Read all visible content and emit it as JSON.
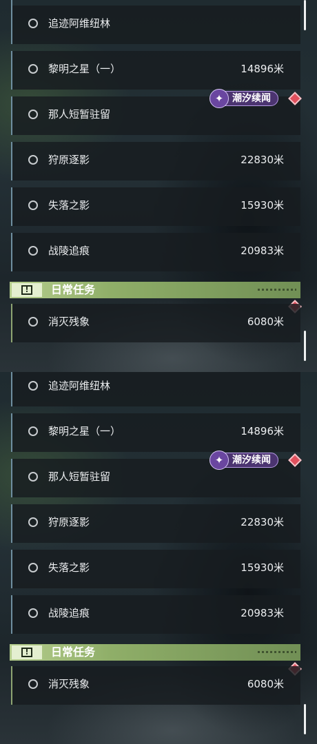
{
  "views": [
    {
      "quests": [
        {
          "name": "追迹阿维纽林",
          "distance": ""
        },
        {
          "name": "黎明之星（一）",
          "distance": "14896米"
        },
        {
          "name": "那人短暂驻留",
          "distance": ""
        },
        {
          "name": "狩原逐影",
          "distance": "22830米"
        },
        {
          "name": "失落之影",
          "distance": "15930米"
        },
        {
          "name": "战陵追痕",
          "distance": "20983米"
        }
      ],
      "badge": {
        "label": "潮汐续闻",
        "icon": "sparkle-icon"
      },
      "section": {
        "title": "日常任务",
        "icon": "exclamation-icon"
      },
      "daily": [
        {
          "name": "消灭残象",
          "distance": "6080米"
        }
      ]
    },
    {
      "quests": [
        {
          "name": "追迹阿维纽林",
          "distance": ""
        },
        {
          "name": "黎明之星（一）",
          "distance": "14896米"
        },
        {
          "name": "那人短暂驻留",
          "distance": ""
        },
        {
          "name": "狩原逐影",
          "distance": "22830米"
        },
        {
          "name": "失落之影",
          "distance": "15930米"
        },
        {
          "name": "战陵追痕",
          "distance": "20983米"
        }
      ],
      "badge": {
        "label": "潮汐续闻",
        "icon": "sparkle-icon"
      },
      "section": {
        "title": "日常任务",
        "icon": "exclamation-icon"
      },
      "daily": [
        {
          "name": "消灭残象",
          "distance": "6080米"
        }
      ]
    }
  ],
  "colors": {
    "quest_border": "#6f8fa0",
    "daily_accent": "#8ea572",
    "badge_purple": "#4b3470",
    "marker_red": "#e0505d"
  }
}
